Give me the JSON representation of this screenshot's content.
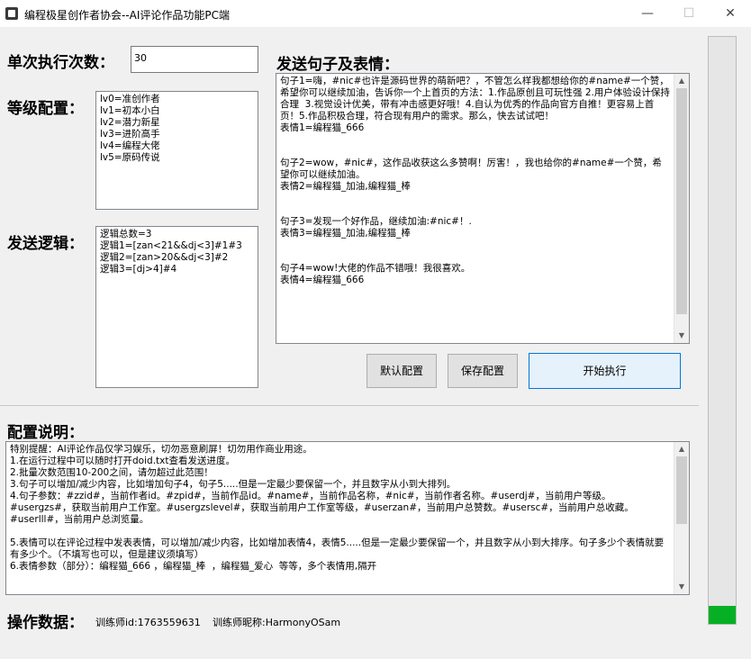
{
  "window": {
    "title": "编程极星创作者协会--AI评论作品功能PC端",
    "minimize": "—",
    "maximize": "☐",
    "close": "✕"
  },
  "exec": {
    "label": "单次执行次数：",
    "value": "30"
  },
  "level": {
    "label": "等级配置：",
    "text": "lv0=准创作者\nlv1=初本小白\nlv2=潜力新星\nlv3=进阶高手\nlv4=编程大佬\nlv5=原码传说"
  },
  "logic": {
    "label": "发送逻辑：",
    "text": "逻辑总数=3\n逻辑1=[zan<21&&dj<3]#1#3\n逻辑2=[zan>20&&dj<3]#2\n逻辑3=[dj>4]#4"
  },
  "sentences": {
    "label": "发送句子及表情：",
    "text": "句子1=嗨，#nic#也许是源码世界的萌新吧？，不管怎么样我都想给你的#name#一个赞，希望你可以继续加油，告诉你一个上首页的方法：1.作品原创且可玩性强 2.用户体验设计保持合理  3.视觉设计优美，带有冲击感更好哦！4.自认为优秀的作品向官方自推！更容易上首页！5.作品积极合理，符合现有用户的需求。那么，快去试试吧！\n表情1=编程猫_666\n\n\n句子2=wow，#nic#，这作品收获这么多赞啊！厉害！，我也给你的#name#一个赞，希望你可以继续加油。\n表情2=编程猫_加油,编程猫_棒\n\n\n句子3=发现一个好作品，继续加油:#nic#！.\n表情3=编程猫_加油,编程猫_棒\n\n\n句子4=wow!大佬的作品不错哦！我很喜欢。\n表情4=编程猫_666"
  },
  "buttons": {
    "default": "默认配置",
    "save": "保存配置",
    "start": "开始执行"
  },
  "config": {
    "label": "配置说明：",
    "text": "特别提醒：AI评论作品仅学习娱乐，切勿恶意刷屏！切勿用作商业用途。\n1.在运行过程中可以随时打开doid.txt查看发送进度。\n2.批量次数范围10-200之间，请勿超过此范围！\n3.句子可以增加/减少内容，比如增加句子4，句子5.....但是一定最少要保留一个，并且数字从小到大排列。\n4.句子参数：#zzid#，当前作者id。#zpid#，当前作品id。#name#，当前作品名称，#nic#，当前作者名称。#userdj#，当前用户等级。#usergzs#，获取当前用户工作室。#usergzslevel#，获取当前用户工作室等级，#userzan#，当前用户总赞数。#usersc#，当前用户总收藏。#userlll#，当前用户总浏览量。\n\n5.表情可以在评论过程中发表表情，可以增加/减少内容，比如增加表情4，表情5.....但是一定最少要保留一个，并且数字从小到大排序。句子多少个表情就要有多少个。（不填写也可以，但是建议须填写）\n6.表情参数（部分）：编程猫_666 ，编程猫_棒  ，编程猫_爱心  等等，多个表情用,隔开"
  },
  "footer": {
    "label": "操作数据：",
    "trainer_id": "训练师id:1763559631",
    "trainer_nick": "训练师昵称:HarmonyOSam"
  },
  "progress": {
    "percent": 3
  }
}
